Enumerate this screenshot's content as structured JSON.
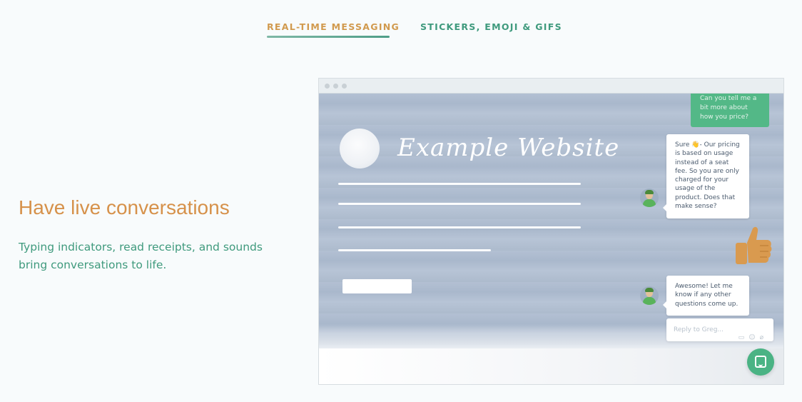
{
  "tabs": [
    {
      "label": "REAL-TIME MESSAGING",
      "active": true
    },
    {
      "label": "STICKERS, EMOJI & GIFS",
      "active": false
    }
  ],
  "feature": {
    "headline": "Have live conversations",
    "description": "Typing indicators, read receipts, and sounds bring conversations to life."
  },
  "demo": {
    "site_title": "Example Website",
    "messages": {
      "user": "Can you tell me a bit more about how you price?",
      "agent_1": "Sure 👋- Our pricing is based on usage instead of a seat fee. So you are only charged for your usage of the product. Does that make sense?",
      "agent_2": "Awesome! Let me know if any other questions come up."
    },
    "reply_placeholder": "Reply to Greg...",
    "reply_icons": [
      "gif-icon",
      "emoji-icon",
      "attachment-icon"
    ],
    "launcher_icon": "chat-icon"
  },
  "colors": {
    "accent_orange": "#d6914a",
    "accent_green": "#3f9a7d",
    "messenger_green": "#4ab384"
  }
}
